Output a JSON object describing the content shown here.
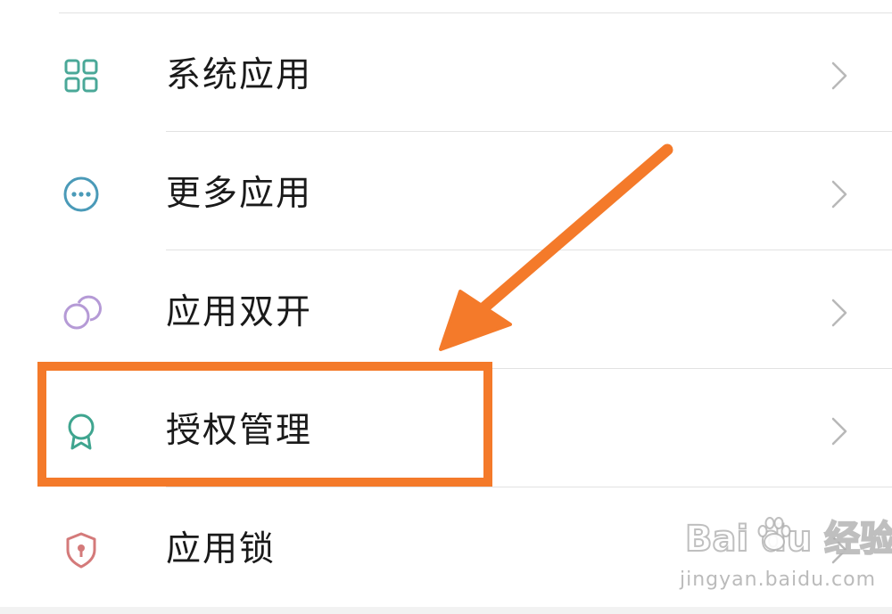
{
  "settings": {
    "items": [
      {
        "label": "系统应用",
        "icon": "grid-icon",
        "icon_color": "#4aa898"
      },
      {
        "label": "更多应用",
        "icon": "more-dots-icon",
        "icon_color": "#4a9ab8"
      },
      {
        "label": "应用双开",
        "icon": "dual-circles-icon",
        "icon_color": "#b59ad6"
      },
      {
        "label": "授权管理",
        "icon": "badge-award-icon",
        "icon_color": "#3fa58f"
      },
      {
        "label": "应用锁",
        "icon": "shield-lock-icon",
        "icon_color": "#d47a7a"
      }
    ]
  },
  "annotation": {
    "highlight_color": "#f47a2a",
    "highlighted_item": "授权管理"
  },
  "watermark": {
    "brand": "Bai du 经验",
    "url": "jingyan.baidu.com"
  }
}
